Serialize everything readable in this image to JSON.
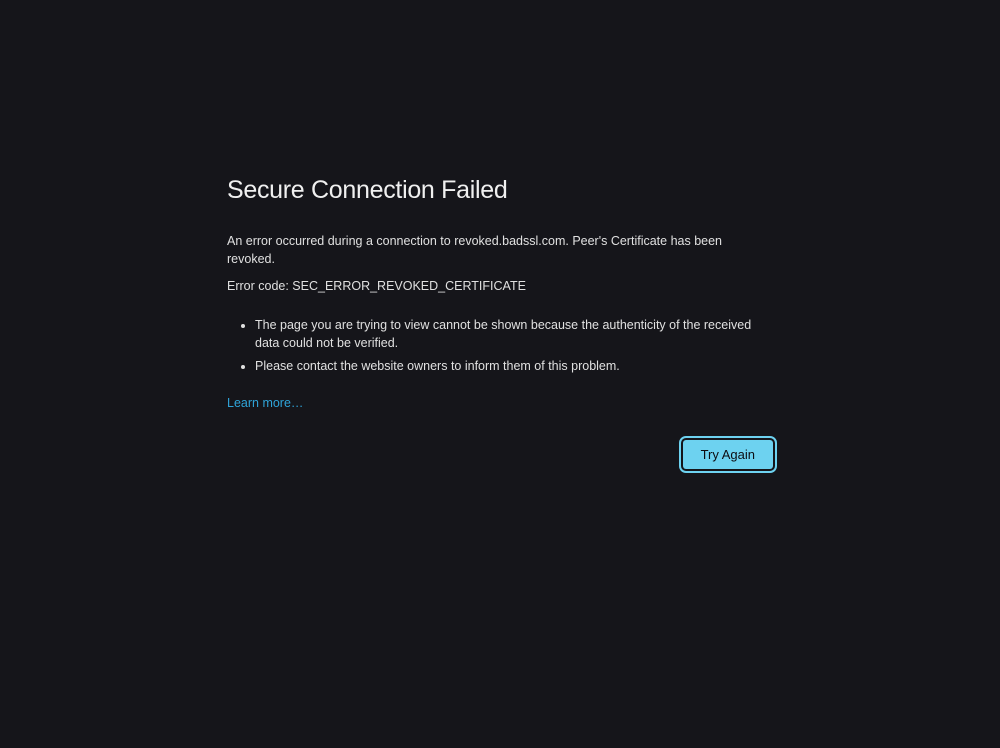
{
  "error": {
    "title": "Secure Connection Failed",
    "message": "An error occurred during a connection to revoked.badssl.com. Peer's Certificate has been revoked.",
    "code_label": "Error code: SEC_ERROR_REVOKED_CERTIFICATE",
    "bullets": [
      "The page you are trying to view cannot be shown because the authenticity of the received data could not be verified.",
      "Please contact the website owners to inform them of this problem."
    ],
    "learn_more_label": "Learn more…",
    "try_again_label": "Try Again"
  }
}
